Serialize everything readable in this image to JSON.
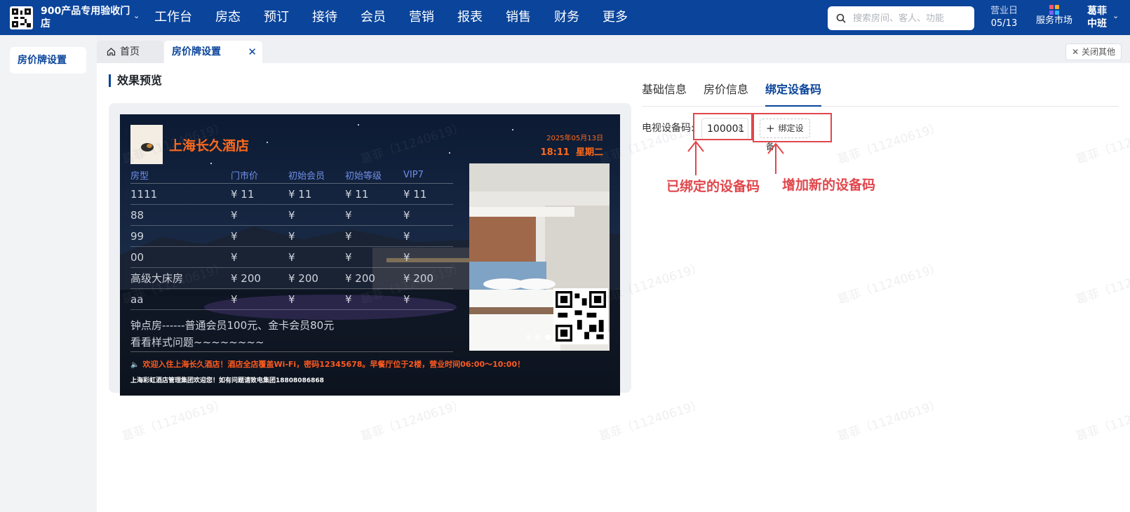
{
  "topbar": {
    "hotel_name": "900产品专用验收门店",
    "nav": [
      "工作台",
      "房态",
      "预订",
      "接待",
      "会员",
      "营销",
      "报表",
      "销售",
      "财务",
      "更多"
    ],
    "search_placeholder": "搜索房间、客人、功能",
    "biz_day_label": "营业日",
    "biz_day_value": "05/13",
    "market_label": "服务市场",
    "user_name": "葛菲",
    "user_shift": "中班"
  },
  "sidebar": {
    "active_item": "房价牌设置"
  },
  "tabs": {
    "home": "首页",
    "active": "房价牌设置",
    "close_others": "关闭其他"
  },
  "preview": {
    "section_title": "效果预览",
    "hotel_name": "上海长久酒店",
    "date": "2025年05月13日",
    "time": "18:11",
    "weekday": "星期二",
    "headers": [
      "房型",
      "门市价",
      "初始会员",
      "初始等级",
      "VIP7"
    ],
    "rows": [
      [
        "1111",
        "¥ 11",
        "¥ 11",
        "¥ 11",
        "¥ 11"
      ],
      [
        "88",
        "¥",
        "¥",
        "¥",
        "¥"
      ],
      [
        "99",
        "¥",
        "¥",
        "¥",
        "¥"
      ],
      [
        "00",
        "¥",
        "¥",
        "¥",
        "¥"
      ],
      [
        "高级大床房",
        "¥ 200",
        "¥ 200",
        "¥ 200",
        "¥ 200"
      ],
      [
        "aa",
        "¥",
        "¥",
        "¥",
        "¥"
      ]
    ],
    "note1": "钟点房------普通会员100元、金卡会员80元",
    "note2": "看看样式问题~~~~~~~~",
    "marquee": "欢迎入住上海长久酒店！酒店全店覆盖Wi-Fi，密码12345678。早餐厅位于2楼，营业时间06:00～10:00！",
    "footer": "上海彩虹酒店管理集团欢迎您！如有问题请致电集团18808086868",
    "carousel_active_index": 2
  },
  "settings": {
    "tabs": [
      "基础信息",
      "房价信息",
      "绑定设备码"
    ],
    "active_tab": "绑定设备码",
    "field_label": "电视设备码",
    "device_code": "100001",
    "bind_button": "绑定设备",
    "annotation_bound": "已绑定的设备码",
    "annotation_add": "增加新的设备码"
  },
  "watermark": "葛菲（11240619）",
  "colors": {
    "brand": "#0a449b",
    "accent": "#ff6a1a",
    "annotation": "#e0474c"
  }
}
